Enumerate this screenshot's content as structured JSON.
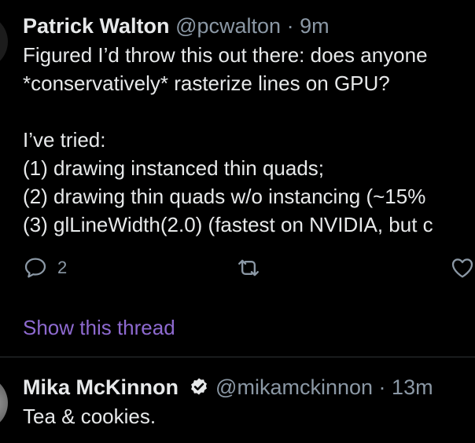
{
  "tweets": [
    {
      "author_name": "Patrick Walton",
      "handle": "@pcwalton",
      "separator": "·",
      "time": "9m",
      "lines": [
        "Figured I’d throw this out there: does anyone",
        "*conservatively* rasterize lines on GPU?",
        "",
        "I’ve tried:",
        "(1) drawing instanced thin quads;",
        "(2) drawing thin quads w/o instancing (~15%",
        "(3) glLineWidth(2.0) (fastest on NVIDIA, but c"
      ],
      "reply_count": "2",
      "show_thread_label": "Show this thread"
    },
    {
      "author_name": "Mika McKinnon",
      "verified": true,
      "handle": "@mikamckinnon",
      "separator": "·",
      "time": "13m",
      "lines": [
        "Tea & cookies."
      ]
    }
  ],
  "icons": {
    "reply": "reply-icon",
    "retweet": "retweet-icon",
    "like": "heart-icon",
    "verified": "verified-badge-icon"
  },
  "colors": {
    "background": "#000000",
    "primary_text": "#e7e9ea",
    "secondary_text": "#8b98a5",
    "link": "#8e6ad0",
    "divider": "#2f3336"
  }
}
